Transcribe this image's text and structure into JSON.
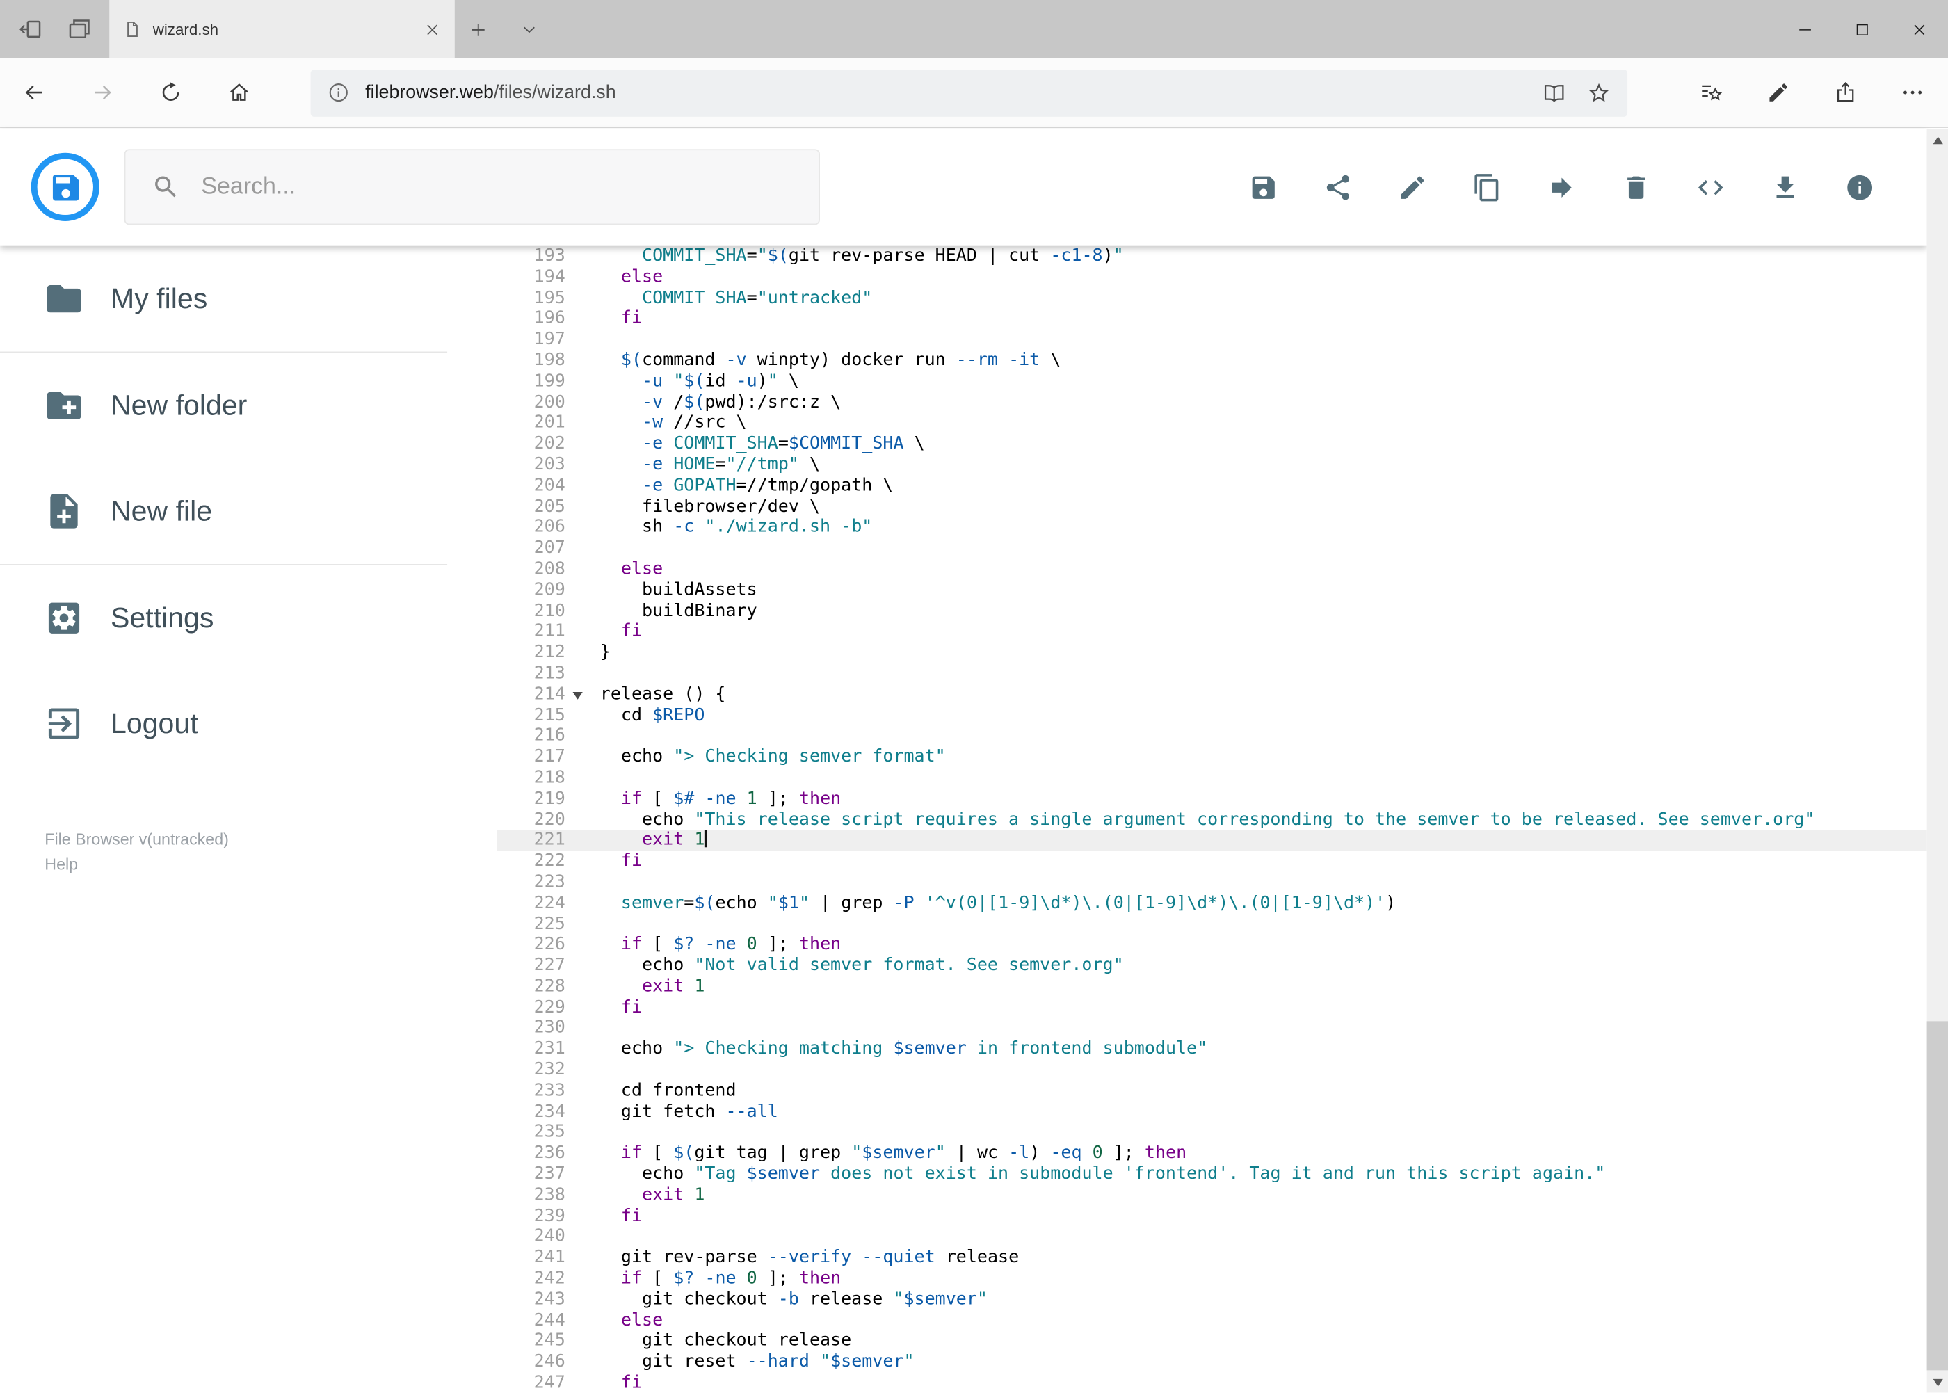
{
  "colors": {
    "accent_blue": "#2196f3",
    "app_icon_gray": "#546e7a",
    "active_line_bg": "#efefef",
    "syntax": {
      "keyword": "#770088",
      "string": "#0f7e8c",
      "variable": "#0b5aa8",
      "flag": "#0b5aa8",
      "number": "#116644",
      "plain": "#000000"
    }
  },
  "browser": {
    "strip_left": [
      {
        "name": "tabs-you-set-aside",
        "icon": "set-aside"
      },
      {
        "name": "tab-preview",
        "icon": "tabs-preview"
      }
    ],
    "tab": {
      "title": "wizard.sh"
    },
    "tab_actions": [
      {
        "name": "new-tab",
        "icon": "plus"
      },
      {
        "name": "tab-list",
        "icon": "chevron-down"
      }
    ],
    "window_controls": [
      {
        "name": "minimize",
        "icon": "minimize"
      },
      {
        "name": "maximize",
        "icon": "maximize"
      },
      {
        "name": "close-window",
        "icon": "close"
      }
    ],
    "nav_buttons": [
      {
        "name": "back",
        "icon": "back",
        "enabled": true
      },
      {
        "name": "forward",
        "icon": "forward",
        "enabled": false
      },
      {
        "name": "refresh",
        "icon": "refresh",
        "enabled": true
      },
      {
        "name": "home",
        "icon": "home",
        "enabled": true
      }
    ],
    "address": {
      "host": "filebrowser.web",
      "path": "/files/wizard.sh",
      "actions": [
        {
          "name": "reading-view",
          "icon": "reader"
        },
        {
          "name": "add-favorite",
          "icon": "star"
        }
      ]
    },
    "toolbar_buttons": [
      {
        "name": "hub-favorites",
        "icon": "hub"
      },
      {
        "name": "web-note",
        "icon": "pen"
      },
      {
        "name": "share-page",
        "icon": "share-up"
      },
      {
        "name": "more-options",
        "icon": "ellipsis"
      }
    ]
  },
  "app": {
    "search_placeholder": "Search...",
    "toolbar": [
      {
        "name": "save",
        "icon": "save"
      },
      {
        "name": "share",
        "icon": "share-nodes"
      },
      {
        "name": "rename",
        "icon": "pencil"
      },
      {
        "name": "copy",
        "icon": "copy"
      },
      {
        "name": "move",
        "icon": "move"
      },
      {
        "name": "delete",
        "icon": "trash"
      },
      {
        "name": "raw-view",
        "icon": "code"
      },
      {
        "name": "download",
        "icon": "download"
      },
      {
        "name": "info",
        "icon": "info"
      }
    ]
  },
  "sidebar": {
    "items": [
      {
        "icon": "folder",
        "label": "My files"
      },
      {
        "icon": "new-folder",
        "label": "New folder"
      },
      {
        "icon": "new-file",
        "label": "New file"
      },
      {
        "icon": "settings",
        "label": "Settings"
      },
      {
        "icon": "logout",
        "label": "Logout"
      }
    ],
    "dividers_after": [
      0,
      2
    ],
    "footer": {
      "version": "File Browser v(untracked)",
      "help": "Help"
    }
  },
  "editor": {
    "active_line": 221,
    "lines": [
      {
        "n": 193,
        "t": [
          [
            "p",
            "    "
          ],
          [
            "d",
            "COMMIT_SHA"
          ],
          [
            "p",
            "="
          ],
          [
            "s",
            "\""
          ],
          [
            "v",
            "$("
          ],
          [
            "p",
            "git rev-parse HEAD | cut "
          ],
          [
            "a",
            "-c1-8"
          ],
          [
            "p",
            ")"
          ],
          [
            "s",
            "\""
          ]
        ]
      },
      {
        "n": 194,
        "t": [
          [
            "p",
            "  "
          ],
          [
            "k",
            "else"
          ]
        ]
      },
      {
        "n": 195,
        "t": [
          [
            "p",
            "    "
          ],
          [
            "d",
            "COMMIT_SHA"
          ],
          [
            "p",
            "="
          ],
          [
            "s",
            "\"untracked\""
          ]
        ]
      },
      {
        "n": 196,
        "t": [
          [
            "p",
            "  "
          ],
          [
            "k",
            "fi"
          ]
        ]
      },
      {
        "n": 197,
        "t": []
      },
      {
        "n": 198,
        "t": [
          [
            "p",
            "  "
          ],
          [
            "v",
            "$("
          ],
          [
            "p",
            "command "
          ],
          [
            "a",
            "-v"
          ],
          [
            "p",
            " winpty) docker run "
          ],
          [
            "a",
            "--rm"
          ],
          [
            "p",
            " "
          ],
          [
            "a",
            "-it"
          ],
          [
            "p",
            " \\"
          ]
        ]
      },
      {
        "n": 199,
        "t": [
          [
            "p",
            "    "
          ],
          [
            "a",
            "-u"
          ],
          [
            "p",
            " "
          ],
          [
            "s",
            "\""
          ],
          [
            "v",
            "$("
          ],
          [
            "p",
            "id "
          ],
          [
            "a",
            "-u"
          ],
          [
            "p",
            ")"
          ],
          [
            "s",
            "\""
          ],
          [
            "p",
            " \\"
          ]
        ]
      },
      {
        "n": 200,
        "t": [
          [
            "p",
            "    "
          ],
          [
            "a",
            "-v"
          ],
          [
            "p",
            " /"
          ],
          [
            "v",
            "$("
          ],
          [
            "p",
            "pwd):/src:z \\"
          ]
        ]
      },
      {
        "n": 201,
        "t": [
          [
            "p",
            "    "
          ],
          [
            "a",
            "-w"
          ],
          [
            "p",
            " //src \\"
          ]
        ]
      },
      {
        "n": 202,
        "t": [
          [
            "p",
            "    "
          ],
          [
            "a",
            "-e"
          ],
          [
            "p",
            " "
          ],
          [
            "d",
            "COMMIT_SHA"
          ],
          [
            "p",
            "="
          ],
          [
            "v",
            "$COMMIT_SHA"
          ],
          [
            "p",
            " \\"
          ]
        ]
      },
      {
        "n": 203,
        "t": [
          [
            "p",
            "    "
          ],
          [
            "a",
            "-e"
          ],
          [
            "p",
            " "
          ],
          [
            "d",
            "HOME"
          ],
          [
            "p",
            "="
          ],
          [
            "s",
            "\"//tmp\""
          ],
          [
            "p",
            " \\"
          ]
        ]
      },
      {
        "n": 204,
        "t": [
          [
            "p",
            "    "
          ],
          [
            "a",
            "-e"
          ],
          [
            "p",
            " "
          ],
          [
            "d",
            "GOPATH"
          ],
          [
            "p",
            "=//tmp/gopath \\"
          ]
        ]
      },
      {
        "n": 205,
        "t": [
          [
            "p",
            "    filebrowser/dev \\"
          ]
        ]
      },
      {
        "n": 206,
        "t": [
          [
            "p",
            "    sh "
          ],
          [
            "a",
            "-c"
          ],
          [
            "p",
            " "
          ],
          [
            "s",
            "\"./wizard.sh -b\""
          ]
        ]
      },
      {
        "n": 207,
        "t": []
      },
      {
        "n": 208,
        "t": [
          [
            "p",
            "  "
          ],
          [
            "k",
            "else"
          ]
        ]
      },
      {
        "n": 209,
        "t": [
          [
            "p",
            "    buildAssets"
          ]
        ]
      },
      {
        "n": 210,
        "t": [
          [
            "p",
            "    buildBinary"
          ]
        ]
      },
      {
        "n": 211,
        "t": [
          [
            "p",
            "  "
          ],
          [
            "k",
            "fi"
          ]
        ]
      },
      {
        "n": 212,
        "t": [
          [
            "p",
            "}"
          ]
        ]
      },
      {
        "n": 213,
        "t": []
      },
      {
        "n": 214,
        "fold": true,
        "t": [
          [
            "p",
            "release () {"
          ]
        ]
      },
      {
        "n": 215,
        "t": [
          [
            "p",
            "  cd "
          ],
          [
            "v",
            "$REPO"
          ]
        ]
      },
      {
        "n": 216,
        "t": []
      },
      {
        "n": 217,
        "t": [
          [
            "p",
            "  echo "
          ],
          [
            "s",
            "\"> Checking semver format\""
          ]
        ]
      },
      {
        "n": 218,
        "t": []
      },
      {
        "n": 219,
        "t": [
          [
            "p",
            "  "
          ],
          [
            "k",
            "if"
          ],
          [
            "p",
            " [ "
          ],
          [
            "v",
            "$#"
          ],
          [
            "p",
            " "
          ],
          [
            "a",
            "-ne"
          ],
          [
            "p",
            " "
          ],
          [
            "n",
            "1"
          ],
          [
            "p",
            " ]; "
          ],
          [
            "k",
            "then"
          ]
        ]
      },
      {
        "n": 220,
        "t": [
          [
            "p",
            "    echo "
          ],
          [
            "s",
            "\"This release script requires a single argument corresponding to the semver to be released. See semver.org\""
          ]
        ]
      },
      {
        "n": 221,
        "t": [
          [
            "p",
            "    "
          ],
          [
            "k",
            "exit"
          ],
          [
            "p",
            " "
          ],
          [
            "n",
            "1"
          ]
        ]
      },
      {
        "n": 222,
        "t": [
          [
            "p",
            "  "
          ],
          [
            "k",
            "fi"
          ]
        ]
      },
      {
        "n": 223,
        "t": []
      },
      {
        "n": 224,
        "t": [
          [
            "p",
            "  "
          ],
          [
            "d",
            "semver"
          ],
          [
            "p",
            "="
          ],
          [
            "v",
            "$("
          ],
          [
            "p",
            "echo "
          ],
          [
            "s",
            "\""
          ],
          [
            "v",
            "$1"
          ],
          [
            "s",
            "\""
          ],
          [
            "p",
            " | grep "
          ],
          [
            "a",
            "-P"
          ],
          [
            "p",
            " "
          ],
          [
            "s",
            "'^v(0|[1-9]\\d*)\\.(0|[1-9]\\d*)\\.(0|[1-9]\\d*)'"
          ],
          [
            "p",
            ")"
          ]
        ]
      },
      {
        "n": 225,
        "t": []
      },
      {
        "n": 226,
        "t": [
          [
            "p",
            "  "
          ],
          [
            "k",
            "if"
          ],
          [
            "p",
            " [ "
          ],
          [
            "v",
            "$?"
          ],
          [
            "p",
            " "
          ],
          [
            "a",
            "-ne"
          ],
          [
            "p",
            " "
          ],
          [
            "n",
            "0"
          ],
          [
            "p",
            " ]; "
          ],
          [
            "k",
            "then"
          ]
        ]
      },
      {
        "n": 227,
        "t": [
          [
            "p",
            "    echo "
          ],
          [
            "s",
            "\"Not valid semver format. See semver.org\""
          ]
        ]
      },
      {
        "n": 228,
        "t": [
          [
            "p",
            "    "
          ],
          [
            "k",
            "exit"
          ],
          [
            "p",
            " "
          ],
          [
            "n",
            "1"
          ]
        ]
      },
      {
        "n": 229,
        "t": [
          [
            "p",
            "  "
          ],
          [
            "k",
            "fi"
          ]
        ]
      },
      {
        "n": 230,
        "t": []
      },
      {
        "n": 231,
        "t": [
          [
            "p",
            "  echo "
          ],
          [
            "s",
            "\"> Checking matching "
          ],
          [
            "v",
            "$semver"
          ],
          [
            "s",
            " in frontend submodule\""
          ]
        ]
      },
      {
        "n": 232,
        "t": []
      },
      {
        "n": 233,
        "t": [
          [
            "p",
            "  cd frontend"
          ]
        ]
      },
      {
        "n": 234,
        "t": [
          [
            "p",
            "  git fetch "
          ],
          [
            "a",
            "--all"
          ]
        ]
      },
      {
        "n": 235,
        "t": []
      },
      {
        "n": 236,
        "t": [
          [
            "p",
            "  "
          ],
          [
            "k",
            "if"
          ],
          [
            "p",
            " [ "
          ],
          [
            "v",
            "$("
          ],
          [
            "p",
            "git tag | grep "
          ],
          [
            "s",
            "\""
          ],
          [
            "v",
            "$semver"
          ],
          [
            "s",
            "\""
          ],
          [
            "p",
            " | wc "
          ],
          [
            "a",
            "-l"
          ],
          [
            "p",
            ") "
          ],
          [
            "a",
            "-eq"
          ],
          [
            "p",
            " "
          ],
          [
            "n",
            "0"
          ],
          [
            "p",
            " ]; "
          ],
          [
            "k",
            "then"
          ]
        ]
      },
      {
        "n": 237,
        "t": [
          [
            "p",
            "    echo "
          ],
          [
            "s",
            "\"Tag "
          ],
          [
            "v",
            "$semver"
          ],
          [
            "s",
            " does not exist in submodule 'frontend'. Tag it and run this script again.\""
          ]
        ]
      },
      {
        "n": 238,
        "t": [
          [
            "p",
            "    "
          ],
          [
            "k",
            "exit"
          ],
          [
            "p",
            " "
          ],
          [
            "n",
            "1"
          ]
        ]
      },
      {
        "n": 239,
        "t": [
          [
            "p",
            "  "
          ],
          [
            "k",
            "fi"
          ]
        ]
      },
      {
        "n": 240,
        "t": []
      },
      {
        "n": 241,
        "t": [
          [
            "p",
            "  git rev-parse "
          ],
          [
            "a",
            "--verify"
          ],
          [
            "p",
            " "
          ],
          [
            "a",
            "--quiet"
          ],
          [
            "p",
            " release"
          ]
        ]
      },
      {
        "n": 242,
        "t": [
          [
            "p",
            "  "
          ],
          [
            "k",
            "if"
          ],
          [
            "p",
            " [ "
          ],
          [
            "v",
            "$?"
          ],
          [
            "p",
            " "
          ],
          [
            "a",
            "-ne"
          ],
          [
            "p",
            " "
          ],
          [
            "n",
            "0"
          ],
          [
            "p",
            " ]; "
          ],
          [
            "k",
            "then"
          ]
        ]
      },
      {
        "n": 243,
        "t": [
          [
            "p",
            "    git checkout "
          ],
          [
            "a",
            "-b"
          ],
          [
            "p",
            " release "
          ],
          [
            "s",
            "\""
          ],
          [
            "v",
            "$semver"
          ],
          [
            "s",
            "\""
          ]
        ]
      },
      {
        "n": 244,
        "t": [
          [
            "p",
            "  "
          ],
          [
            "k",
            "else"
          ]
        ]
      },
      {
        "n": 245,
        "t": [
          [
            "p",
            "    git checkout release"
          ]
        ]
      },
      {
        "n": 246,
        "t": [
          [
            "p",
            "    git reset "
          ],
          [
            "a",
            "--hard"
          ],
          [
            "p",
            " "
          ],
          [
            "s",
            "\""
          ],
          [
            "v",
            "$semver"
          ],
          [
            "s",
            "\""
          ]
        ]
      },
      {
        "n": 247,
        "t": [
          [
            "p",
            "  "
          ],
          [
            "k",
            "fi"
          ]
        ]
      }
    ]
  }
}
